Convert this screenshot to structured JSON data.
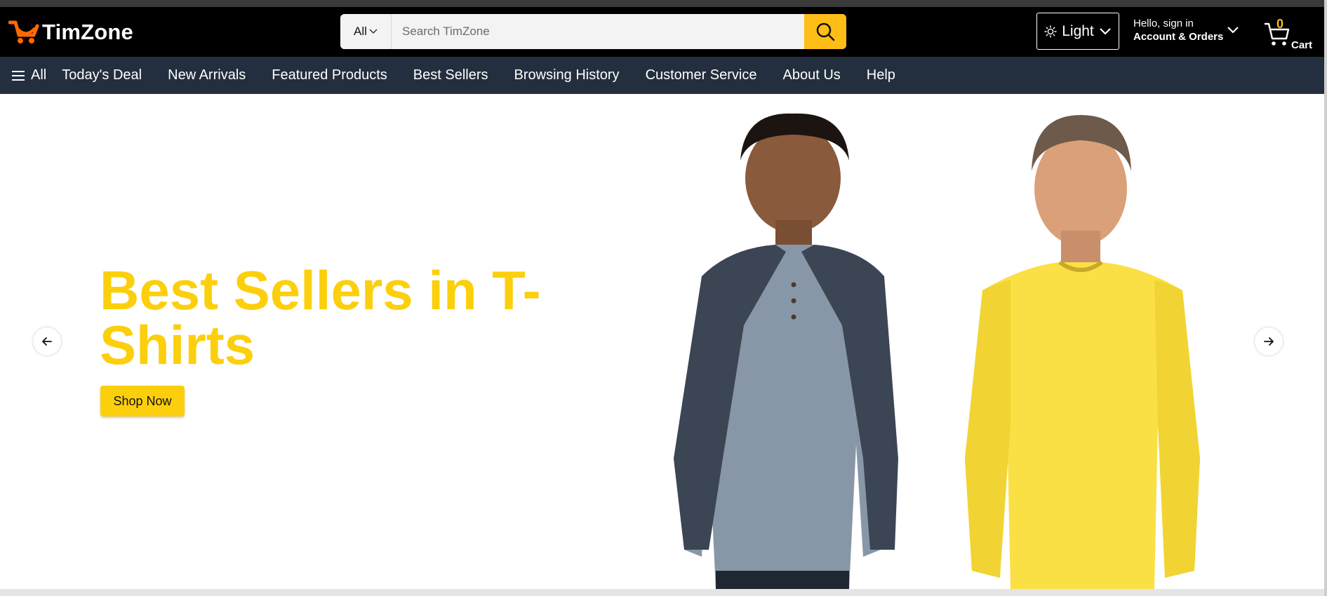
{
  "brand": {
    "name": "TimZone",
    "accent": "#febd17",
    "logo_icon": "cart-logo-icon"
  },
  "search": {
    "category": "All",
    "placeholder": "Search TimZone",
    "icon": "search-icon"
  },
  "theme": {
    "label": "Light",
    "icon": "sun-icon"
  },
  "account": {
    "greeting": "Hello, sign in",
    "label": "Account & Orders"
  },
  "cart": {
    "count": "0",
    "label": "Cart"
  },
  "nav": {
    "all_label": "All",
    "items": [
      "Today's Deal",
      "New Arrivals",
      "Featured Products",
      "Best Sellers",
      "Browsing History",
      "Customer Service",
      "About Us",
      "Help"
    ]
  },
  "hero": {
    "title": "Best Sellers in T-Shirts",
    "cta": "Shop Now",
    "title_color": "#fccf0c",
    "image_alt": "two men wearing long sleeve t-shirts"
  }
}
